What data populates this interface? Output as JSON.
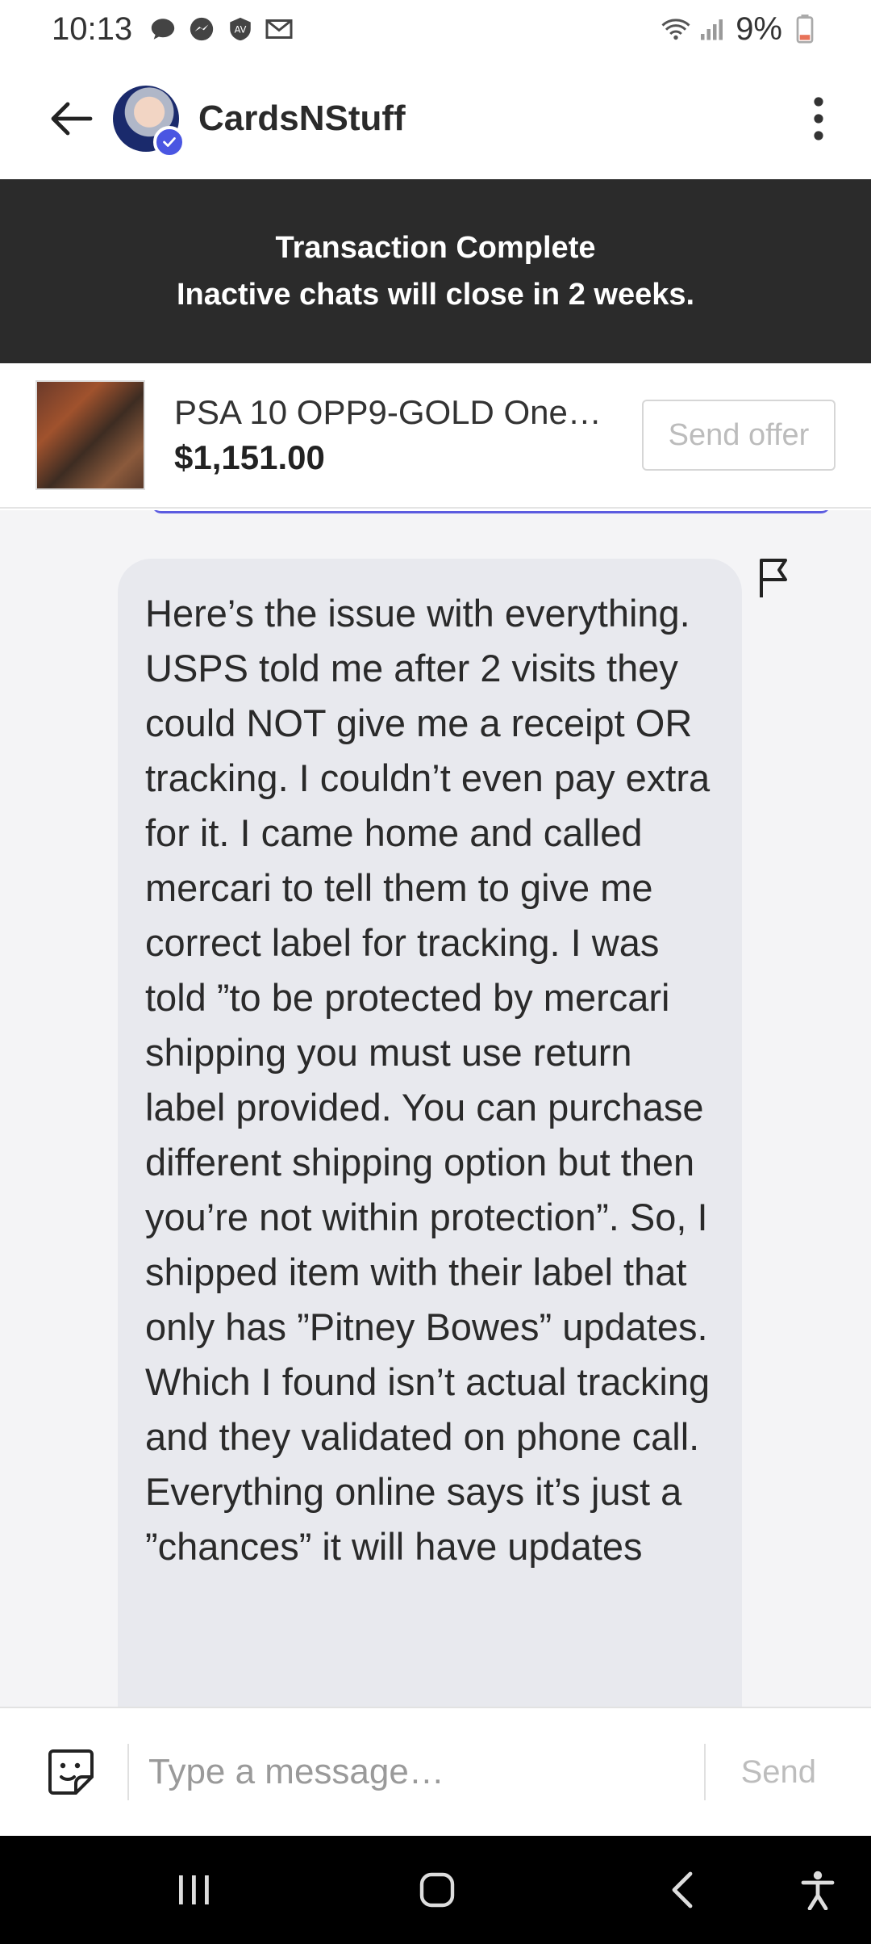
{
  "status_bar": {
    "time": "10:13",
    "battery": "9%"
  },
  "header": {
    "seller_name": "CardsNStuff"
  },
  "banner": {
    "line1": "Transaction Complete",
    "line2": "Inactive chats will close in 2 weeks."
  },
  "item": {
    "title": "PSA 10 OPP9-GOLD One…",
    "price": "$1,151.00",
    "send_offer_label": "Send offer"
  },
  "message": {
    "text": "Here’s the issue with everything. USPS told me after 2 visits they could NOT  give me a receipt OR tracking. I couldn’t even pay extra for it. I came home and called mercari to tell them to give me correct label for tracking. I was told ”to be protected by mercari shipping you must use return label provided. You can purchase different shipping option but then you’re not within protection”. So, I shipped item with their label that only has ”Pitney Bowes” updates. Which I found isn’t actual tracking and they validated on phone call. Everything online says it’s just a ”chances” it will have updates"
  },
  "composer": {
    "placeholder": "Type a message…",
    "send_label": "Send"
  },
  "colors": {
    "banner_bg": "#2b2b2b",
    "bubble_bg": "#e8e9ee",
    "accent": "#4a56e2"
  },
  "icons": [
    "back-arrow-icon",
    "verified-icon",
    "more-vertical-icon",
    "flag-icon",
    "sticker-icon",
    "recents-icon",
    "home-icon",
    "nav-back-icon",
    "accessibility-icon"
  ]
}
